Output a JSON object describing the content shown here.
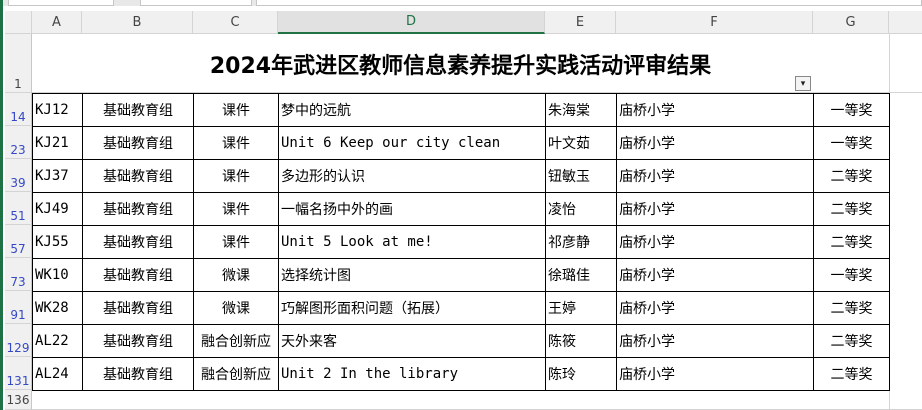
{
  "sheet": {
    "columns": [
      "A",
      "B",
      "C",
      "D",
      "E",
      "F",
      "G"
    ],
    "selected_column": "D",
    "title": "2024年武进区教师信息素养提升实践活动评审结果",
    "title_row": "1",
    "last_row": "136",
    "accent_color": "#217346",
    "filtered_row_color": "#3548c6",
    "icons": {
      "filter": "filter-dropdown-icon"
    },
    "rows": [
      {
        "row": "14",
        "code": "KJ12",
        "group": "基础教育组",
        "type": "课件",
        "work": "梦中的远航",
        "author": "朱海棠",
        "school": "庙桥小学",
        "award": "一等奖"
      },
      {
        "row": "23",
        "code": "KJ21",
        "group": "基础教育组",
        "type": "课件",
        "work": "Unit 6 Keep our city clean",
        "author": "叶文茹",
        "school": "庙桥小学",
        "award": "一等奖"
      },
      {
        "row": "39",
        "code": "KJ37",
        "group": "基础教育组",
        "type": "课件",
        "work": "多边形的认识",
        "author": "钮敏玉",
        "school": "庙桥小学",
        "award": "二等奖"
      },
      {
        "row": "51",
        "code": "KJ49",
        "group": "基础教育组",
        "type": "课件",
        "work": "一幅名扬中外的画",
        "author": "凌怡",
        "school": "庙桥小学",
        "award": "二等奖"
      },
      {
        "row": "57",
        "code": "KJ55",
        "group": "基础教育组",
        "type": "课件",
        "work": "Unit 5 Look at me!",
        "author": "祁彦静",
        "school": "庙桥小学",
        "award": "二等奖"
      },
      {
        "row": "73",
        "code": "WK10",
        "group": "基础教育组",
        "type": "微课",
        "work": "选择统计图",
        "author": "徐璐佳",
        "school": "庙桥小学",
        "award": "一等奖"
      },
      {
        "row": "91",
        "code": "WK28",
        "group": "基础教育组",
        "type": "微课",
        "work": "巧解图形面积问题（拓展）",
        "author": "王婷",
        "school": "庙桥小学",
        "award": "二等奖"
      },
      {
        "row": "129",
        "code": "AL22",
        "group": "基础教育组",
        "type": "融合创新应",
        "work": "天外来客",
        "author": "陈筱",
        "school": "庙桥小学",
        "award": "二等奖"
      },
      {
        "row": "131",
        "code": "AL24",
        "group": "基础教育组",
        "type": "融合创新应",
        "work": "Unit 2 In the library",
        "author": "陈玲",
        "school": "庙桥小学",
        "award": "二等奖"
      }
    ]
  }
}
